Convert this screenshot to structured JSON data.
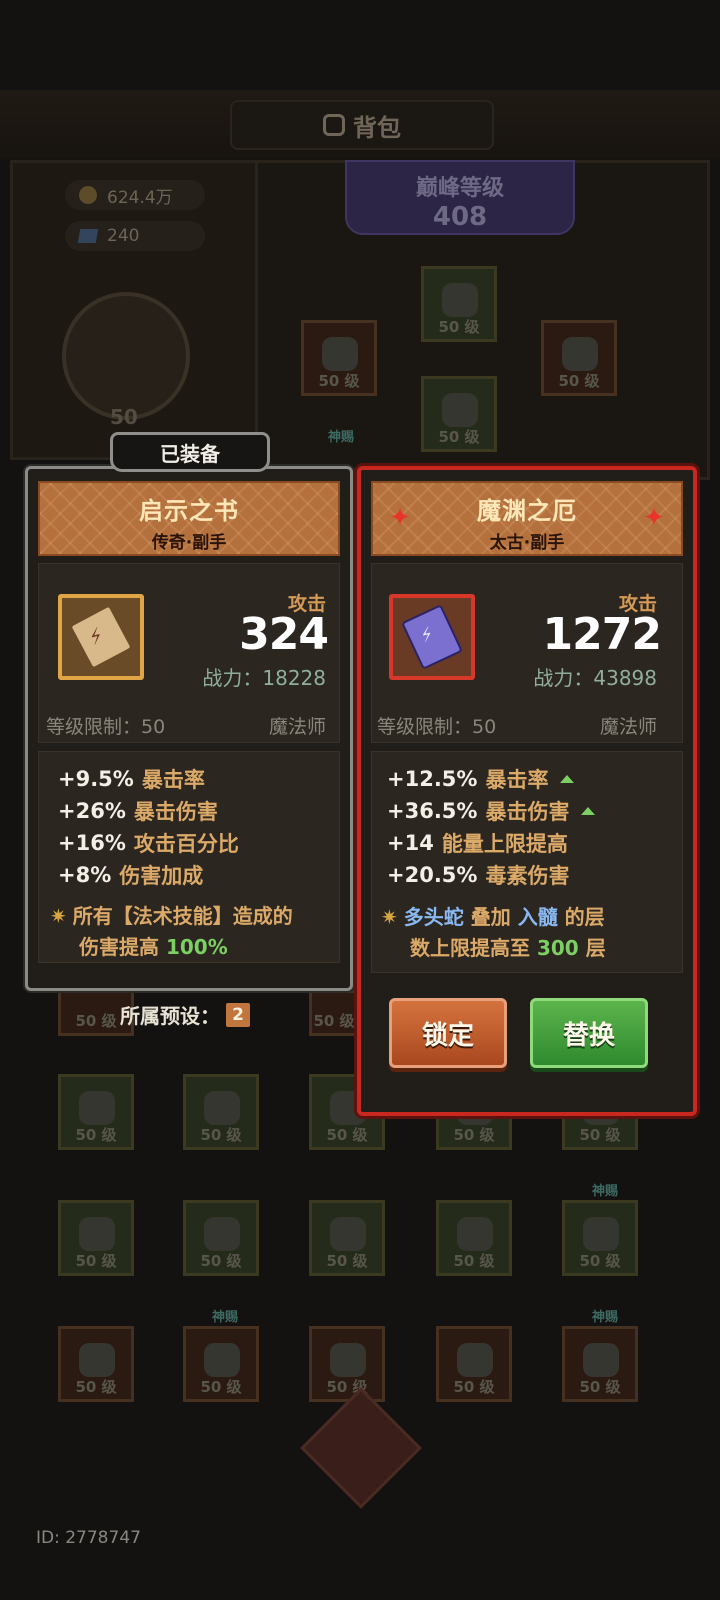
{
  "header": {
    "title": "背包"
  },
  "currency": {
    "gold": "624.4万",
    "gems": "240"
  },
  "peak": {
    "title": "巅峰等级",
    "level": "408"
  },
  "avatar": {
    "level": "50"
  },
  "equipped_tag": "已装备",
  "slot_level_label": "50 级",
  "divine_tag": "神赐",
  "left_card": {
    "name": "启示之书",
    "subtitle": "传奇·副手",
    "stat_label": "攻击",
    "stat_value": "324",
    "power": "战力：18228",
    "level_req": "等级限制：50",
    "class": "魔法师",
    "attributes": [
      {
        "value": "+9.5%",
        "name": "暴击率"
      },
      {
        "value": "+26%",
        "name": "暴击伤害"
      },
      {
        "value": "+16%",
        "name": "攻击百分比"
      },
      {
        "value": "+8%",
        "name": "伤害加成"
      }
    ],
    "skill": {
      "line1": "所有【法术技能】造成的",
      "line2": "伤害提高",
      "value": "100%"
    }
  },
  "right_card": {
    "name": "魔渊之厄",
    "subtitle": "太古·副手",
    "stat_label": "攻击",
    "stat_value": "1272",
    "power": "战力：43898",
    "level_req": "等级限制：50",
    "class": "魔法师",
    "attributes": [
      {
        "value": "+12.5%",
        "name": "暴击率"
      },
      {
        "value": "+36.5%",
        "name": "暴击伤害"
      },
      {
        "value": "+14",
        "name": "能量上限提高"
      },
      {
        "value": "+20.5%",
        "name": "毒素伤害"
      }
    ],
    "skill": {
      "w1": "多头蛇",
      "w2": "叠加",
      "w3": "入髓",
      "w4": "的层",
      "w5": "数上限提高至",
      "w6": "300",
      "w7": "层"
    }
  },
  "preset": {
    "label": "所属预设：",
    "number": "2"
  },
  "buttons": {
    "lock": "锁定",
    "replace": "替换"
  },
  "footer": {
    "id": "ID: 2778747"
  }
}
